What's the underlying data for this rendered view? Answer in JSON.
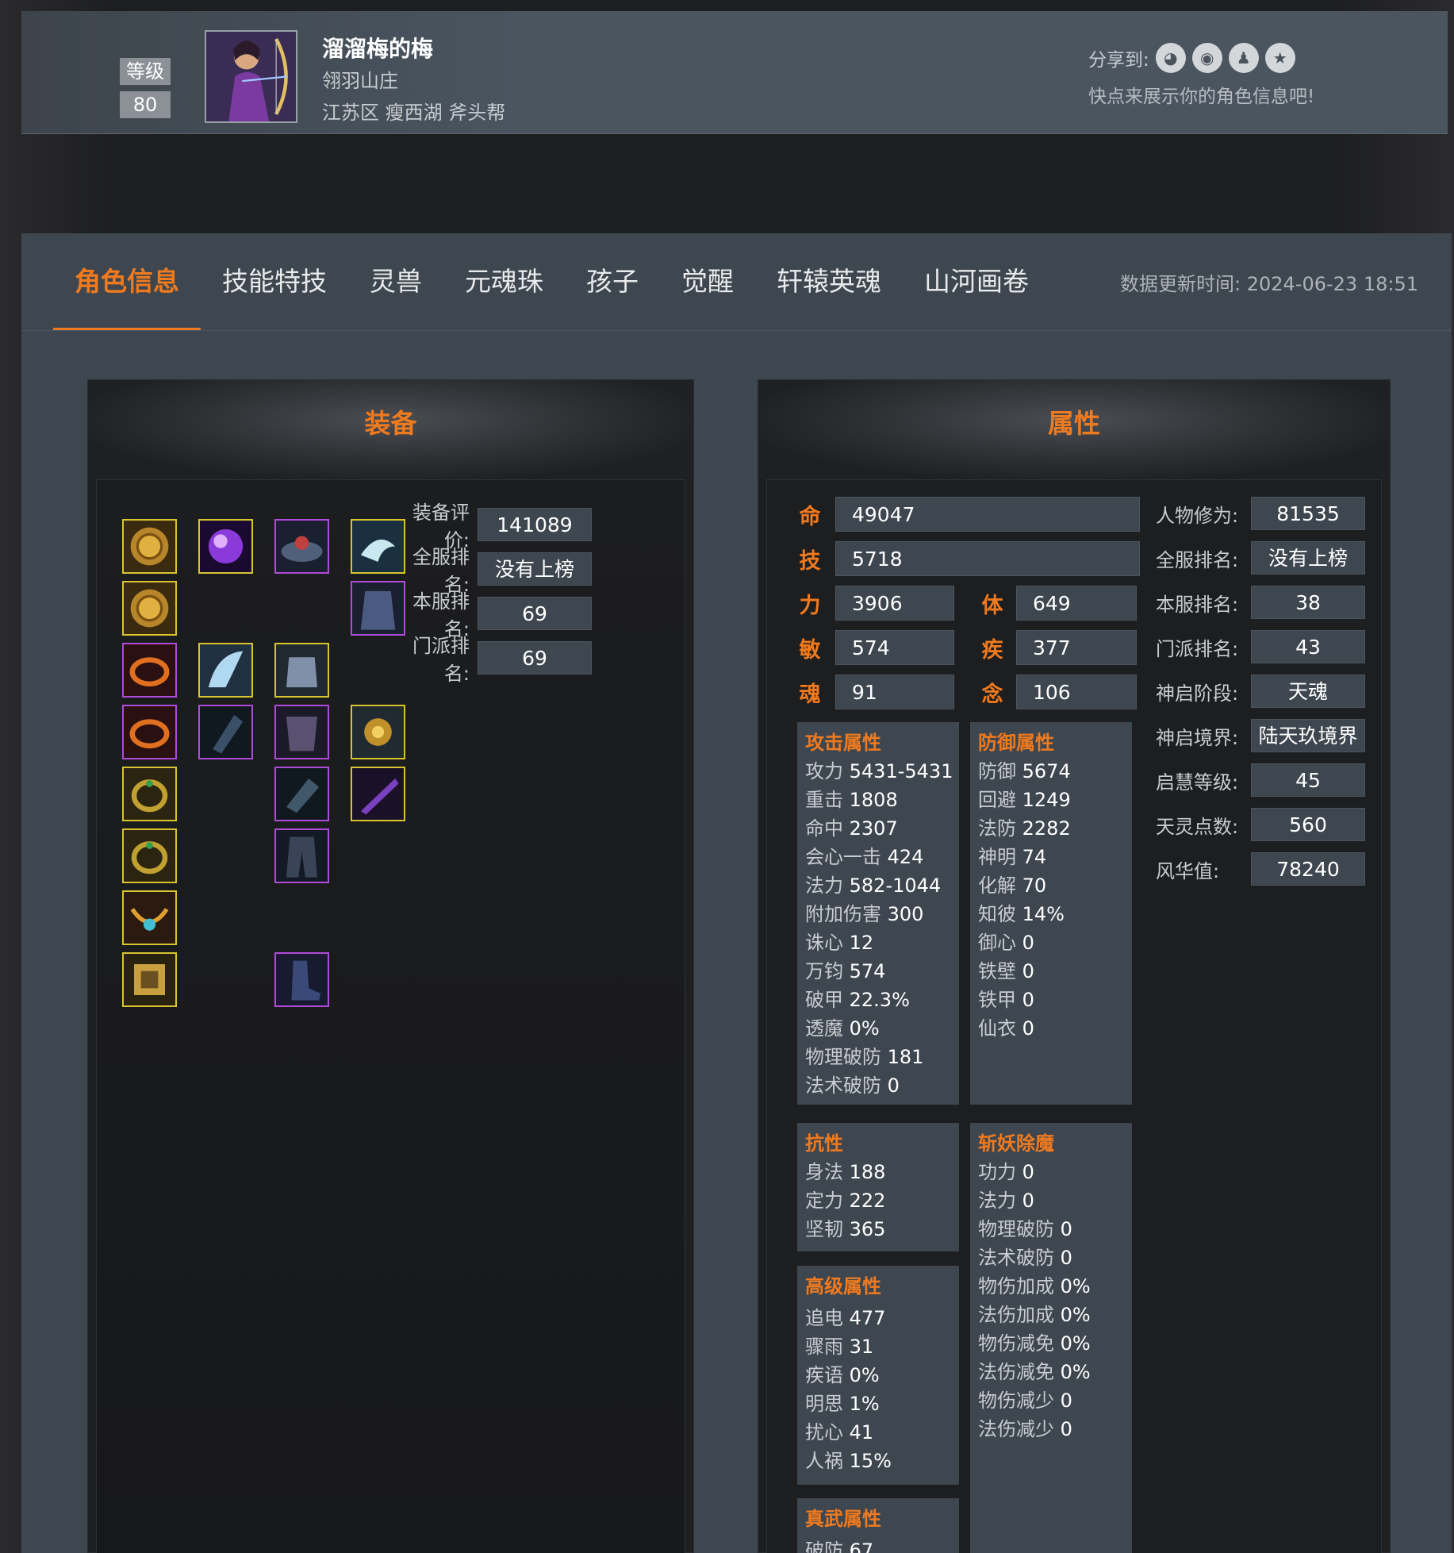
{
  "profile": {
    "level_label": "等级",
    "level": "80",
    "name": "溜溜梅的梅",
    "faction": "翎羽山庄",
    "server": "江苏区 瘦西湖 斧头帮",
    "share_label": "分享到:",
    "share_icons": [
      "wechat-icon",
      "weibo-icon",
      "qq-icon",
      "qzone-icon"
    ],
    "share_hint": "快点来展示你的角色信息吧!"
  },
  "tabs": [
    "角色信息",
    "技能特技",
    "灵兽",
    "元魂珠",
    "孩子",
    "觉醒",
    "轩辕英魂",
    "山河画卷"
  ],
  "update_label": "数据更新时间:",
  "update_time": "2024-06-23 18:51",
  "equipment": {
    "title": "装备",
    "ratings": [
      {
        "label": "装备评价:",
        "value": "141089"
      },
      {
        "label": "全服排名:",
        "value": "没有上榜"
      },
      {
        "label": "本服排名:",
        "value": "69"
      },
      {
        "label": "门派排名:",
        "value": "69"
      }
    ]
  },
  "attributes": {
    "title": "属性",
    "core": [
      {
        "key": "命",
        "value": "49047"
      },
      {
        "key": "技",
        "value": "5718"
      },
      {
        "key": "力",
        "value": "3906"
      },
      {
        "key": "体",
        "value": "649"
      },
      {
        "key": "敏",
        "value": "574"
      },
      {
        "key": "疾",
        "value": "377"
      },
      {
        "key": "魂",
        "value": "91"
      },
      {
        "key": "念",
        "value": "106"
      }
    ],
    "attack": {
      "title": "攻击属性",
      "items": [
        [
          "攻力",
          "5431-5431"
        ],
        [
          "重击",
          "1808"
        ],
        [
          "命中",
          "2307"
        ],
        [
          "会心一击",
          "424"
        ],
        [
          "法力",
          "582-1044"
        ],
        [
          "附加伤害",
          "300"
        ],
        [
          "诛心",
          "12"
        ],
        [
          "万钧",
          "574"
        ],
        [
          "破甲",
          "22.3%"
        ],
        [
          "透魔",
          "0%"
        ],
        [
          "物理破防",
          "181"
        ],
        [
          "法术破防",
          "0"
        ]
      ]
    },
    "defense": {
      "title": "防御属性",
      "items": [
        [
          "防御",
          "5674"
        ],
        [
          "回避",
          "1249"
        ],
        [
          "法防",
          "2282"
        ],
        [
          "神明",
          "74"
        ],
        [
          "化解",
          "70"
        ],
        [
          "知彼",
          "14%"
        ],
        [
          "御心",
          "0"
        ],
        [
          "铁壁",
          "0"
        ],
        [
          "铁甲",
          "0"
        ],
        [
          "仙衣",
          "0"
        ]
      ]
    },
    "resist": {
      "title": "抗性",
      "items": [
        [
          "身法",
          "188"
        ],
        [
          "定力",
          "222"
        ],
        [
          "坚韧",
          "365"
        ]
      ]
    },
    "demon": {
      "title": "斩妖除魔",
      "items": [
        [
          "功力",
          "0"
        ],
        [
          "法力",
          "0"
        ],
        [
          "物理破防",
          "0"
        ],
        [
          "法术破防",
          "0"
        ],
        [
          "物伤加成",
          "0%"
        ],
        [
          "法伤加成",
          "0%"
        ],
        [
          "物伤减免",
          "0%"
        ],
        [
          "法伤减免",
          "0%"
        ],
        [
          "物伤减少",
          "0"
        ],
        [
          "法伤减少",
          "0"
        ]
      ]
    },
    "advanced": {
      "title": "高级属性",
      "items": [
        [
          "追电",
          "477"
        ],
        [
          "骤雨",
          "31"
        ],
        [
          "疾语",
          "0%"
        ],
        [
          "明思",
          "1%"
        ],
        [
          "扰心",
          "41"
        ],
        [
          "人祸",
          "15%"
        ]
      ]
    },
    "zhenwu": {
      "title": "真武属性",
      "items": [
        [
          "破防",
          "67"
        ]
      ]
    },
    "right": [
      {
        "label": "人物修为:",
        "value": "81535"
      },
      {
        "label": "全服排名:",
        "value": "没有上榜"
      },
      {
        "label": "本服排名:",
        "value": "38"
      },
      {
        "label": "门派排名:",
        "value": "43"
      },
      {
        "label": "神启阶段:",
        "value": "天魂"
      },
      {
        "label": "神启境界:",
        "value": "陆天玖境界"
      },
      {
        "label": "启慧等级:",
        "value": "45"
      },
      {
        "label": "天灵点数:",
        "value": "560"
      },
      {
        "label": "风华值:",
        "value": "78240"
      }
    ]
  }
}
